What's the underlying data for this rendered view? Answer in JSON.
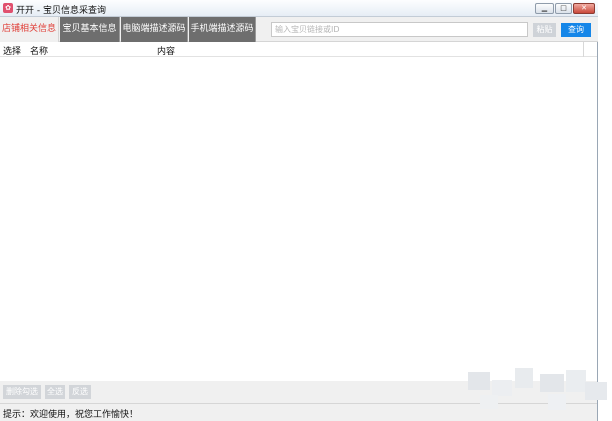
{
  "window": {
    "title": "开开 - 宝贝信息采查询",
    "app_icon": "app-logo-icon"
  },
  "tabs": [
    {
      "label": "店铺相关信息",
      "active": true
    },
    {
      "label": "宝贝基本信息",
      "active": false
    },
    {
      "label": "电脑端描述源码",
      "active": false
    },
    {
      "label": "手机端描述源码",
      "active": false
    }
  ],
  "search": {
    "placeholder": "输入宝贝链接或ID",
    "value": ""
  },
  "buttons": {
    "paste": "粘贴",
    "query": "查询",
    "delete_checked": "删除勾选",
    "select_all": "全选",
    "invert": "反选"
  },
  "table": {
    "columns": [
      "选择",
      "名称",
      "内容"
    ],
    "rows": []
  },
  "status": {
    "text": "提示：欢迎使用，祝您工作愉快！"
  },
  "colors": {
    "accent": "#1586e8",
    "active_tab_text": "#e0413a",
    "dark_tab": "#6e6e6e"
  }
}
